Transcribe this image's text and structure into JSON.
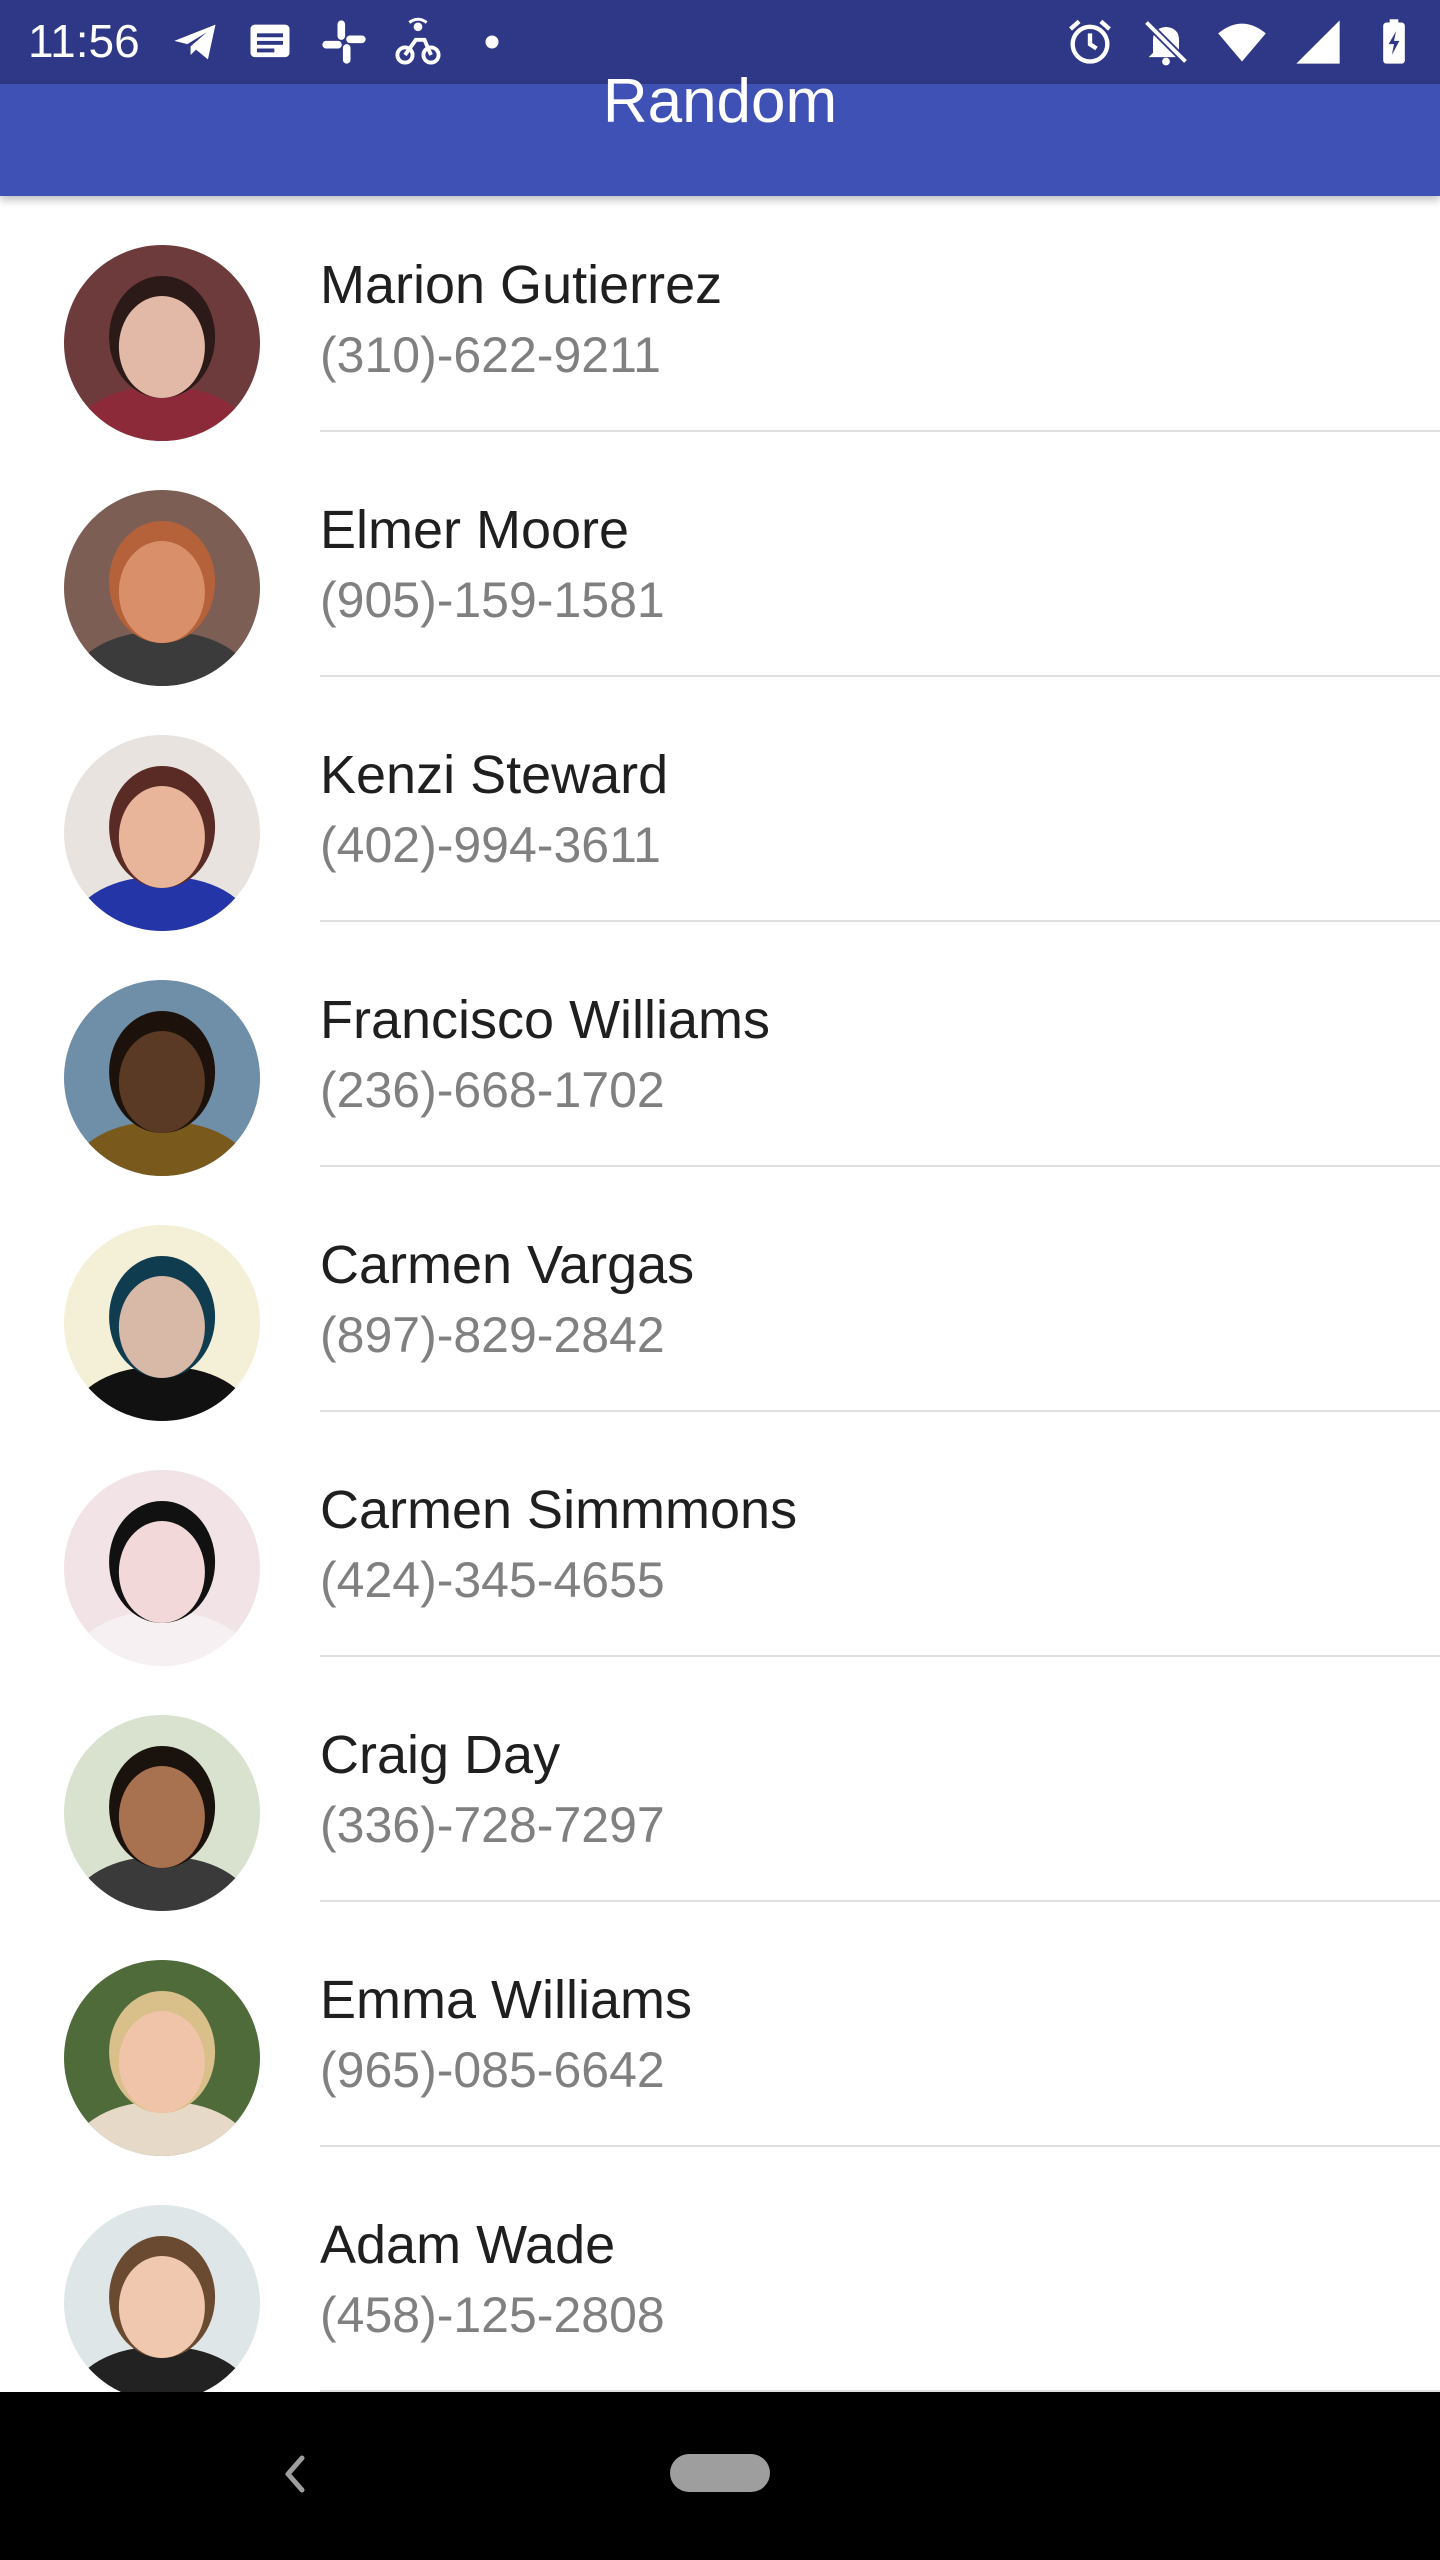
{
  "status_bar": {
    "time": "11:56",
    "left_icons": [
      "telegram-icon",
      "message-icon",
      "slack-icon",
      "bike-delivery-icon",
      "dot-icon"
    ],
    "right_icons": [
      "alarm-icon",
      "notifications-off-icon",
      "wifi-icon",
      "signal-icon",
      "battery-charging-icon"
    ]
  },
  "app_bar": {
    "title": "Random",
    "color": "#3f51b5"
  },
  "contacts": [
    {
      "name": "Marion Gutierrez",
      "phone": "(310)-622-9211",
      "avatar": {
        "bg": "#6e3b3c",
        "skin": "#e2b8a6",
        "hair": "#2b1a18",
        "shirt": "#8c2a3a"
      }
    },
    {
      "name": "Elmer Moore",
      "phone": "(905)-159-1581",
      "avatar": {
        "bg": "#7d5e55",
        "skin": "#d9906a",
        "hair": "#b5623a",
        "shirt": "#3b3b3b"
      }
    },
    {
      "name": "Kenzi Steward",
      "phone": "(402)-994-3611",
      "avatar": {
        "bg": "#e9e3df",
        "skin": "#e8b49a",
        "hair": "#5a2b25",
        "shirt": "#2435a8"
      }
    },
    {
      "name": "Francisco Williams",
      "phone": "(236)-668-1702",
      "avatar": {
        "bg": "#6f8ea8",
        "skin": "#5a3a24",
        "hair": "#1c120b",
        "shirt": "#7a5a1c"
      }
    },
    {
      "name": "Carmen Vargas",
      "phone": "(897)-829-2842",
      "avatar": {
        "bg": "#f4f0d8",
        "skin": "#d8b8a6",
        "hair": "#0f3c4e",
        "shirt": "#111111"
      }
    },
    {
      "name": "Carmen Simmmons",
      "phone": "(424)-345-4655",
      "avatar": {
        "bg": "#f1e3e6",
        "skin": "#f2d8d8",
        "hair": "#111111",
        "shirt": "#f7f0f2"
      }
    },
    {
      "name": "Craig Day",
      "phone": "(336)-728-7297",
      "avatar": {
        "bg": "#d9e2cf",
        "skin": "#a87250",
        "hair": "#1a120d",
        "shirt": "#3a3a3a"
      }
    },
    {
      "name": "Emma Williams",
      "phone": "(965)-085-6642",
      "avatar": {
        "bg": "#4f6b3a",
        "skin": "#f0c4a8",
        "hair": "#d9c08a",
        "shirt": "#e6d9c7"
      }
    },
    {
      "name": "Adam Wade",
      "phone": "(458)-125-2808",
      "avatar": {
        "bg": "#dfe6e8",
        "skin": "#f0c8b0",
        "hair": "#6a4a30",
        "shirt": "#222222"
      }
    }
  ],
  "nav_bar": {
    "back_icon": "back-chevron-icon",
    "home_icon": "home-pill-icon"
  }
}
